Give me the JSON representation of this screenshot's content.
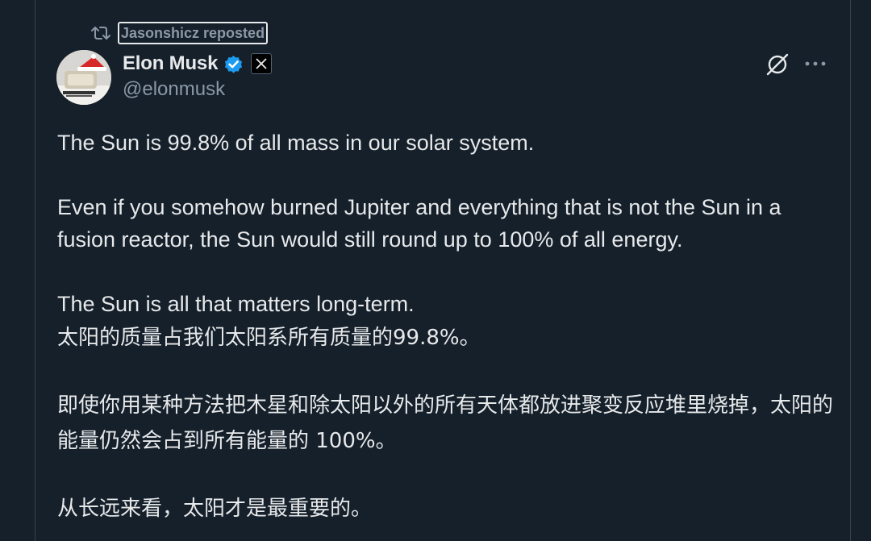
{
  "repost": {
    "label": "Jasonshicz reposted",
    "icon": "repost-icon"
  },
  "author": {
    "display_name": "Elon Musk",
    "handle": "@elonmusk",
    "verified": true,
    "verified_color": "#1d9bf0",
    "affiliate_badge": "x-logo-icon"
  },
  "actions": {
    "grok_icon": "grok-icon",
    "more_icon": "more-icon"
  },
  "tweet": {
    "en_p1": "The Sun is 99.8% of all mass in our solar system.",
    "en_p2": "Even if you somehow burned Jupiter and everything that is not the Sun in a fusion reactor, the Sun would still round up to 100% of all energy.",
    "en_p3": "The Sun is all that matters long-term.",
    "zh_p1": "太阳的质量占我们太阳系所有质量的99.8%。",
    "zh_p2": "即使你用某种方法把木星和除太阳以外的所有天体都放进聚变反应堆里烧掉，太阳的能量仍然会占到所有能量的 100%。",
    "zh_p3": "从长远来看，太阳才是最重要的。"
  },
  "colors": {
    "background": "#15202b",
    "text_primary": "#e7e9ea",
    "text_secondary": "#8b98a5",
    "border": "#38444d"
  }
}
